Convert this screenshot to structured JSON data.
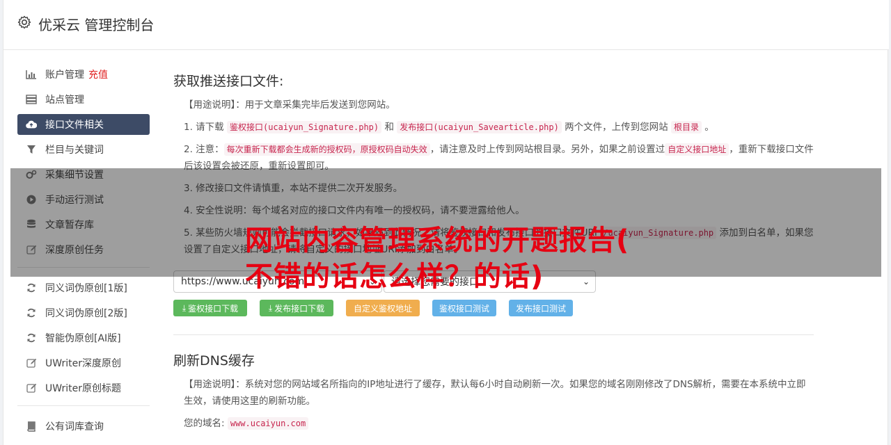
{
  "app": {
    "title": "优采云 管理控制台",
    "icon": "gear-icon"
  },
  "sidebar": {
    "items": [
      {
        "label": "账户管理",
        "extra": "充值",
        "icon": "bar-chart-icon",
        "active": false
      },
      {
        "label": "站点管理",
        "icon": "server-icon",
        "active": false
      },
      {
        "label": "接口文件相关",
        "icon": "cloud-upload-icon",
        "active": true
      },
      {
        "label": "栏目与关键词",
        "icon": "filter-icon",
        "active": false
      },
      {
        "label": "采集细节设置",
        "icon": "cogs-icon",
        "active": false
      },
      {
        "label": "手动运行测试",
        "icon": "play-circle-icon",
        "active": false
      },
      {
        "label": "文章暂存库",
        "icon": "database-icon",
        "active": false
      },
      {
        "label": "深度原创任务",
        "icon": "edit-icon",
        "active": false
      },
      {
        "label": "同义词伪原创[1版]",
        "icon": "refresh-icon",
        "active": false
      },
      {
        "label": "同义词伪原创[2版]",
        "icon": "refresh-icon",
        "active": false
      },
      {
        "label": "智能伪原创[AI版]",
        "icon": "refresh-icon",
        "active": false
      },
      {
        "label": "UWriter深度原创",
        "icon": "edit-icon",
        "active": false
      },
      {
        "label": "UWriter原创标题",
        "icon": "edit-icon",
        "active": false
      },
      {
        "label": "公有词库查询",
        "icon": "book-icon",
        "active": false
      }
    ]
  },
  "main": {
    "section1": {
      "title": "获取推送接口文件:",
      "usage_label": "【用途说明】",
      "usage_text": "：用于文章采集完毕后发送到您网站。",
      "p1": {
        "a": "1. 请下载",
        "code1": "鉴权接口(ucaiyun_Signature.php)",
        "b": "和",
        "code2": "发布接口(ucaiyun_Savearticle.php)",
        "c": "两个文件，上传到您网站",
        "code3": "根目录",
        "d": "。"
      },
      "p2": {
        "a": "2. 注意：",
        "code1": "每次重新下载都会生成新的授权码，原授权码自动失效",
        "b": "，请注意及时上传到网站根目录。另外，如果之前设置过",
        "code2": "自定义接口地址",
        "c": "，重新下载接口文件后该设置会被还原，重新设置即可。"
      },
      "p3": "3. 修改接口文件请慎重，本站不提供二次开发服务。",
      "p4": "4. 安全性说明：每个域名对应的接口文件内有唯一的授权码，请不要泄露给他人。",
      "p5": {
        "a": "5. 某些防火墙规则可能会拦截接口请求，如果遇到此情况，请将鉴权接口和发布接口的接口文件URI",
        "code1": "/ucaiyun_Signature.php",
        "b": "添加到白名单，如果您设置了自定义接口地址，请将自定义的接口地址URI添加到白名单。"
      },
      "select_site": "https://www.ucaiyun.com",
      "select_need": "请选择您需要的接口",
      "buttons": {
        "auth_download": "鉴权接口下载",
        "publish_download": "发布接口下载",
        "custom_auth": "自定义鉴权地址",
        "auth_test": "鉴权接口测试",
        "publish_test": "发布接口测试"
      }
    },
    "section2": {
      "title": "刷新DNS缓存",
      "usage_label": "【用途说明】",
      "usage_text": "：系统对您的网站域名所指向的IP地址进行了缓存，默认每6小时自动刷新一次。如果您的域名刚刚修改了DNS解析，需要在本系统中立即生效，请使用这里的刷新功能。",
      "domain_label": "您的域名:",
      "domain_value": "www.ucaiyun.com"
    }
  },
  "watermark": {
    "line1": "网站内容管理系统的开题报告(",
    "line2": "不错的话怎么样？的话)"
  },
  "colors": {
    "active_nav": "#3d4b66",
    "green": "#5cb85c",
    "orange": "#f0ad4e",
    "blue": "#62b1e8",
    "watermark": "#e60012"
  }
}
